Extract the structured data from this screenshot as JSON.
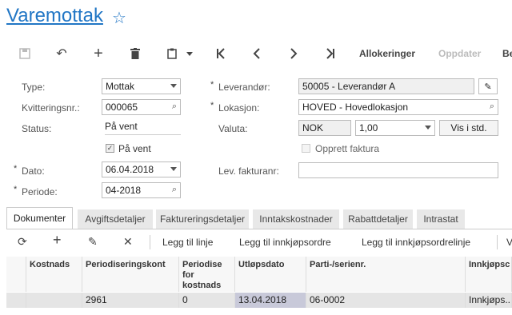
{
  "header": {
    "title": "Varemottak",
    "favorite_icon": "star-outline-icon"
  },
  "toolbar": {
    "allocations_label": "Allokeringer",
    "update_label": "Oppdater",
    "more_label": "Be"
  },
  "form": {
    "type_label": "Type:",
    "type_value": "Mottak",
    "receipt_no_label": "Kvitteringsnr.:",
    "receipt_no_value": "000065",
    "status_label": "Status:",
    "status_value": "På vent",
    "on_hold_label": "På vent",
    "date_label": "Dato:",
    "date_value": "06.04.2018",
    "period_label": "Periode:",
    "period_value": "04-2018",
    "supplier_label": "Leverandør:",
    "supplier_value": "50005 - Leverandør A",
    "location_label": "Lokasjon:",
    "location_value": "HOVED - Hovedlokasjon",
    "currency_label": "Valuta:",
    "currency_value": "NOK",
    "rate_value": "1,00",
    "view_base_label": "Vis i std.",
    "create_invoice_label": "Opprett faktura",
    "supplier_invoice_label": "Lev. fakturanr:",
    "supplier_invoice_value": ""
  },
  "tabs": [
    {
      "label": "Dokumenter"
    },
    {
      "label": "Avgiftsdetaljer"
    },
    {
      "label": "Faktureringsdetaljer"
    },
    {
      "label": "Inntakskostnader"
    },
    {
      "label": "Rabattdetaljer"
    },
    {
      "label": "Intrastat"
    }
  ],
  "grid_toolbar": {
    "add_line": "Legg til linje",
    "add_po": "Legg til innkjøpsordre",
    "add_po_line": "Legg til innkjøpsordrelinje",
    "more": "V"
  },
  "grid": {
    "columns": [
      "Kostnads",
      "Periodiseringskont",
      "Periodise for kostnads",
      "Utløpsdato",
      "Parti-/serienr.",
      "Innkjøpsc"
    ],
    "row": [
      "",
      "2961",
      "0",
      "13.04.2018",
      "06-0002",
      "Innkjøps.."
    ]
  }
}
